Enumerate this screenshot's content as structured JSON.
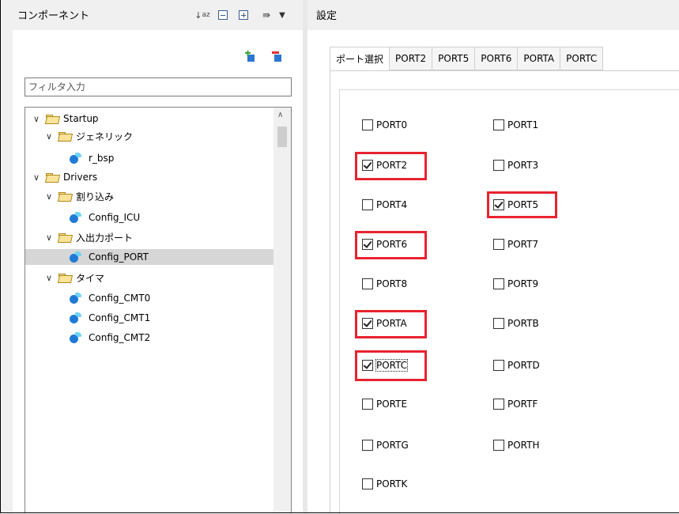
{
  "left": {
    "title": "コンポーネント",
    "filter_placeholder": "フィルタ入力",
    "tree": {
      "startup": "Startup",
      "generic": "ジェネリック",
      "r_bsp": "r_bsp",
      "drivers": "Drivers",
      "interrupt": "割り込み",
      "config_icu": "Config_ICU",
      "io_port": "入出力ポート",
      "config_port": "Config_PORT",
      "timer": "タイマ",
      "config_cmt0": "Config_CMT0",
      "config_cmt1": "Config_CMT1",
      "config_cmt2": "Config_CMT2"
    }
  },
  "right": {
    "title": "設定",
    "tabs": [
      "ポート選択",
      "PORT2",
      "PORT5",
      "PORT6",
      "PORTA",
      "PORTC"
    ],
    "ports": [
      {
        "label": "PORT0",
        "checked": false
      },
      {
        "label": "PORT1",
        "checked": false
      },
      {
        "label": "PORT2",
        "checked": true
      },
      {
        "label": "PORT3",
        "checked": false
      },
      {
        "label": "PORT4",
        "checked": false
      },
      {
        "label": "PORT5",
        "checked": true
      },
      {
        "label": "PORT6",
        "checked": true
      },
      {
        "label": "PORT7",
        "checked": false
      },
      {
        "label": "PORT8",
        "checked": false
      },
      {
        "label": "PORT9",
        "checked": false
      },
      {
        "label": "PORTA",
        "checked": true
      },
      {
        "label": "PORTB",
        "checked": false
      },
      {
        "label": "PORTC",
        "checked": true
      },
      {
        "label": "PORTD",
        "checked": false
      },
      {
        "label": "PORTE",
        "checked": false
      },
      {
        "label": "PORTF",
        "checked": false
      },
      {
        "label": "PORTG",
        "checked": false
      },
      {
        "label": "PORTH",
        "checked": false
      },
      {
        "label": "PORTK",
        "checked": false
      }
    ]
  },
  "colors": {
    "highlight": "#e8232f",
    "selection": "#d6d6d6",
    "panel_bg": "#f0f0f0"
  },
  "icons": [
    "sort-az-icon",
    "collapse-all-icon",
    "expand-all-icon",
    "link-icon",
    "dropdown-icon",
    "add-component-icon",
    "remove-component-icon",
    "folder-icon",
    "component-icon"
  ]
}
